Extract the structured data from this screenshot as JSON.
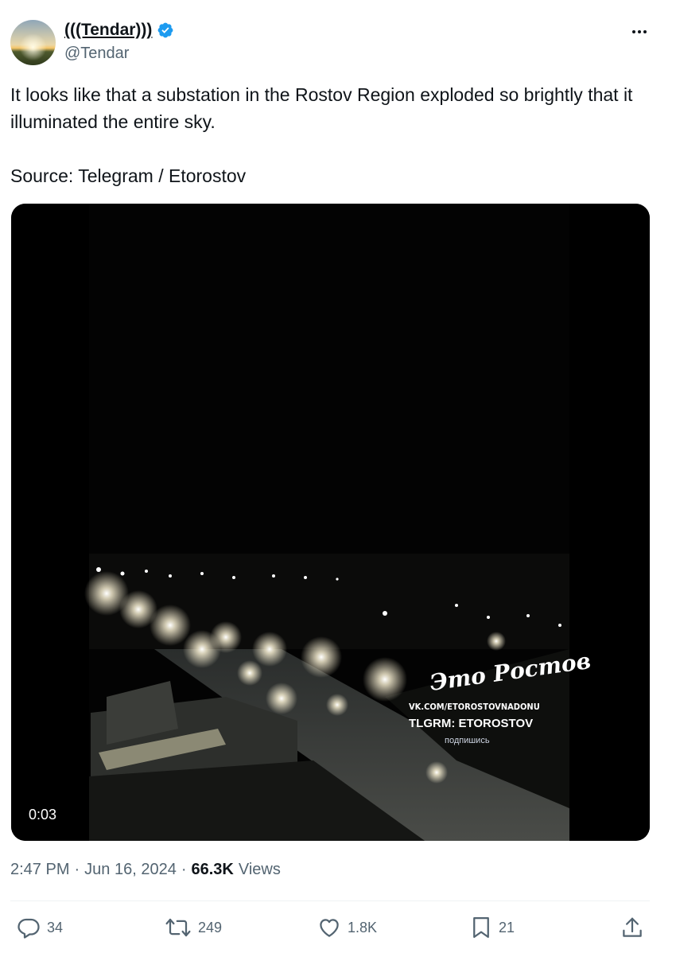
{
  "author": {
    "display_name": "(((Tendar)))",
    "handle": "@Tendar",
    "verified_badge_icon": "verified-badge-icon"
  },
  "tweet": {
    "paragraphs": [
      "It looks like that a substation in the Rostov Region exploded so brightly that it illuminated the entire sky.",
      "Source: Telegram / Etorostov"
    ]
  },
  "media": {
    "duration": "0:03",
    "watermark_logo": "Это Ростов",
    "watermark_lines": [
      "VK.COM/ETOROSTOVNADONU",
      "TLGRM: ETOROSTOV",
      "подпишись"
    ]
  },
  "meta": {
    "time": "2:47 PM",
    "separator": "·",
    "date": "Jun 16, 2024",
    "views_count": "66.3K",
    "views_label": "Views"
  },
  "actions": {
    "reply_count": "34",
    "repost_count": "249",
    "like_count": "1.8K",
    "bookmark_count": "21"
  },
  "colors": {
    "text_primary": "#0f1419",
    "text_secondary": "#536471",
    "verified_blue": "#1d9bf0",
    "divider": "#eff3f4"
  }
}
